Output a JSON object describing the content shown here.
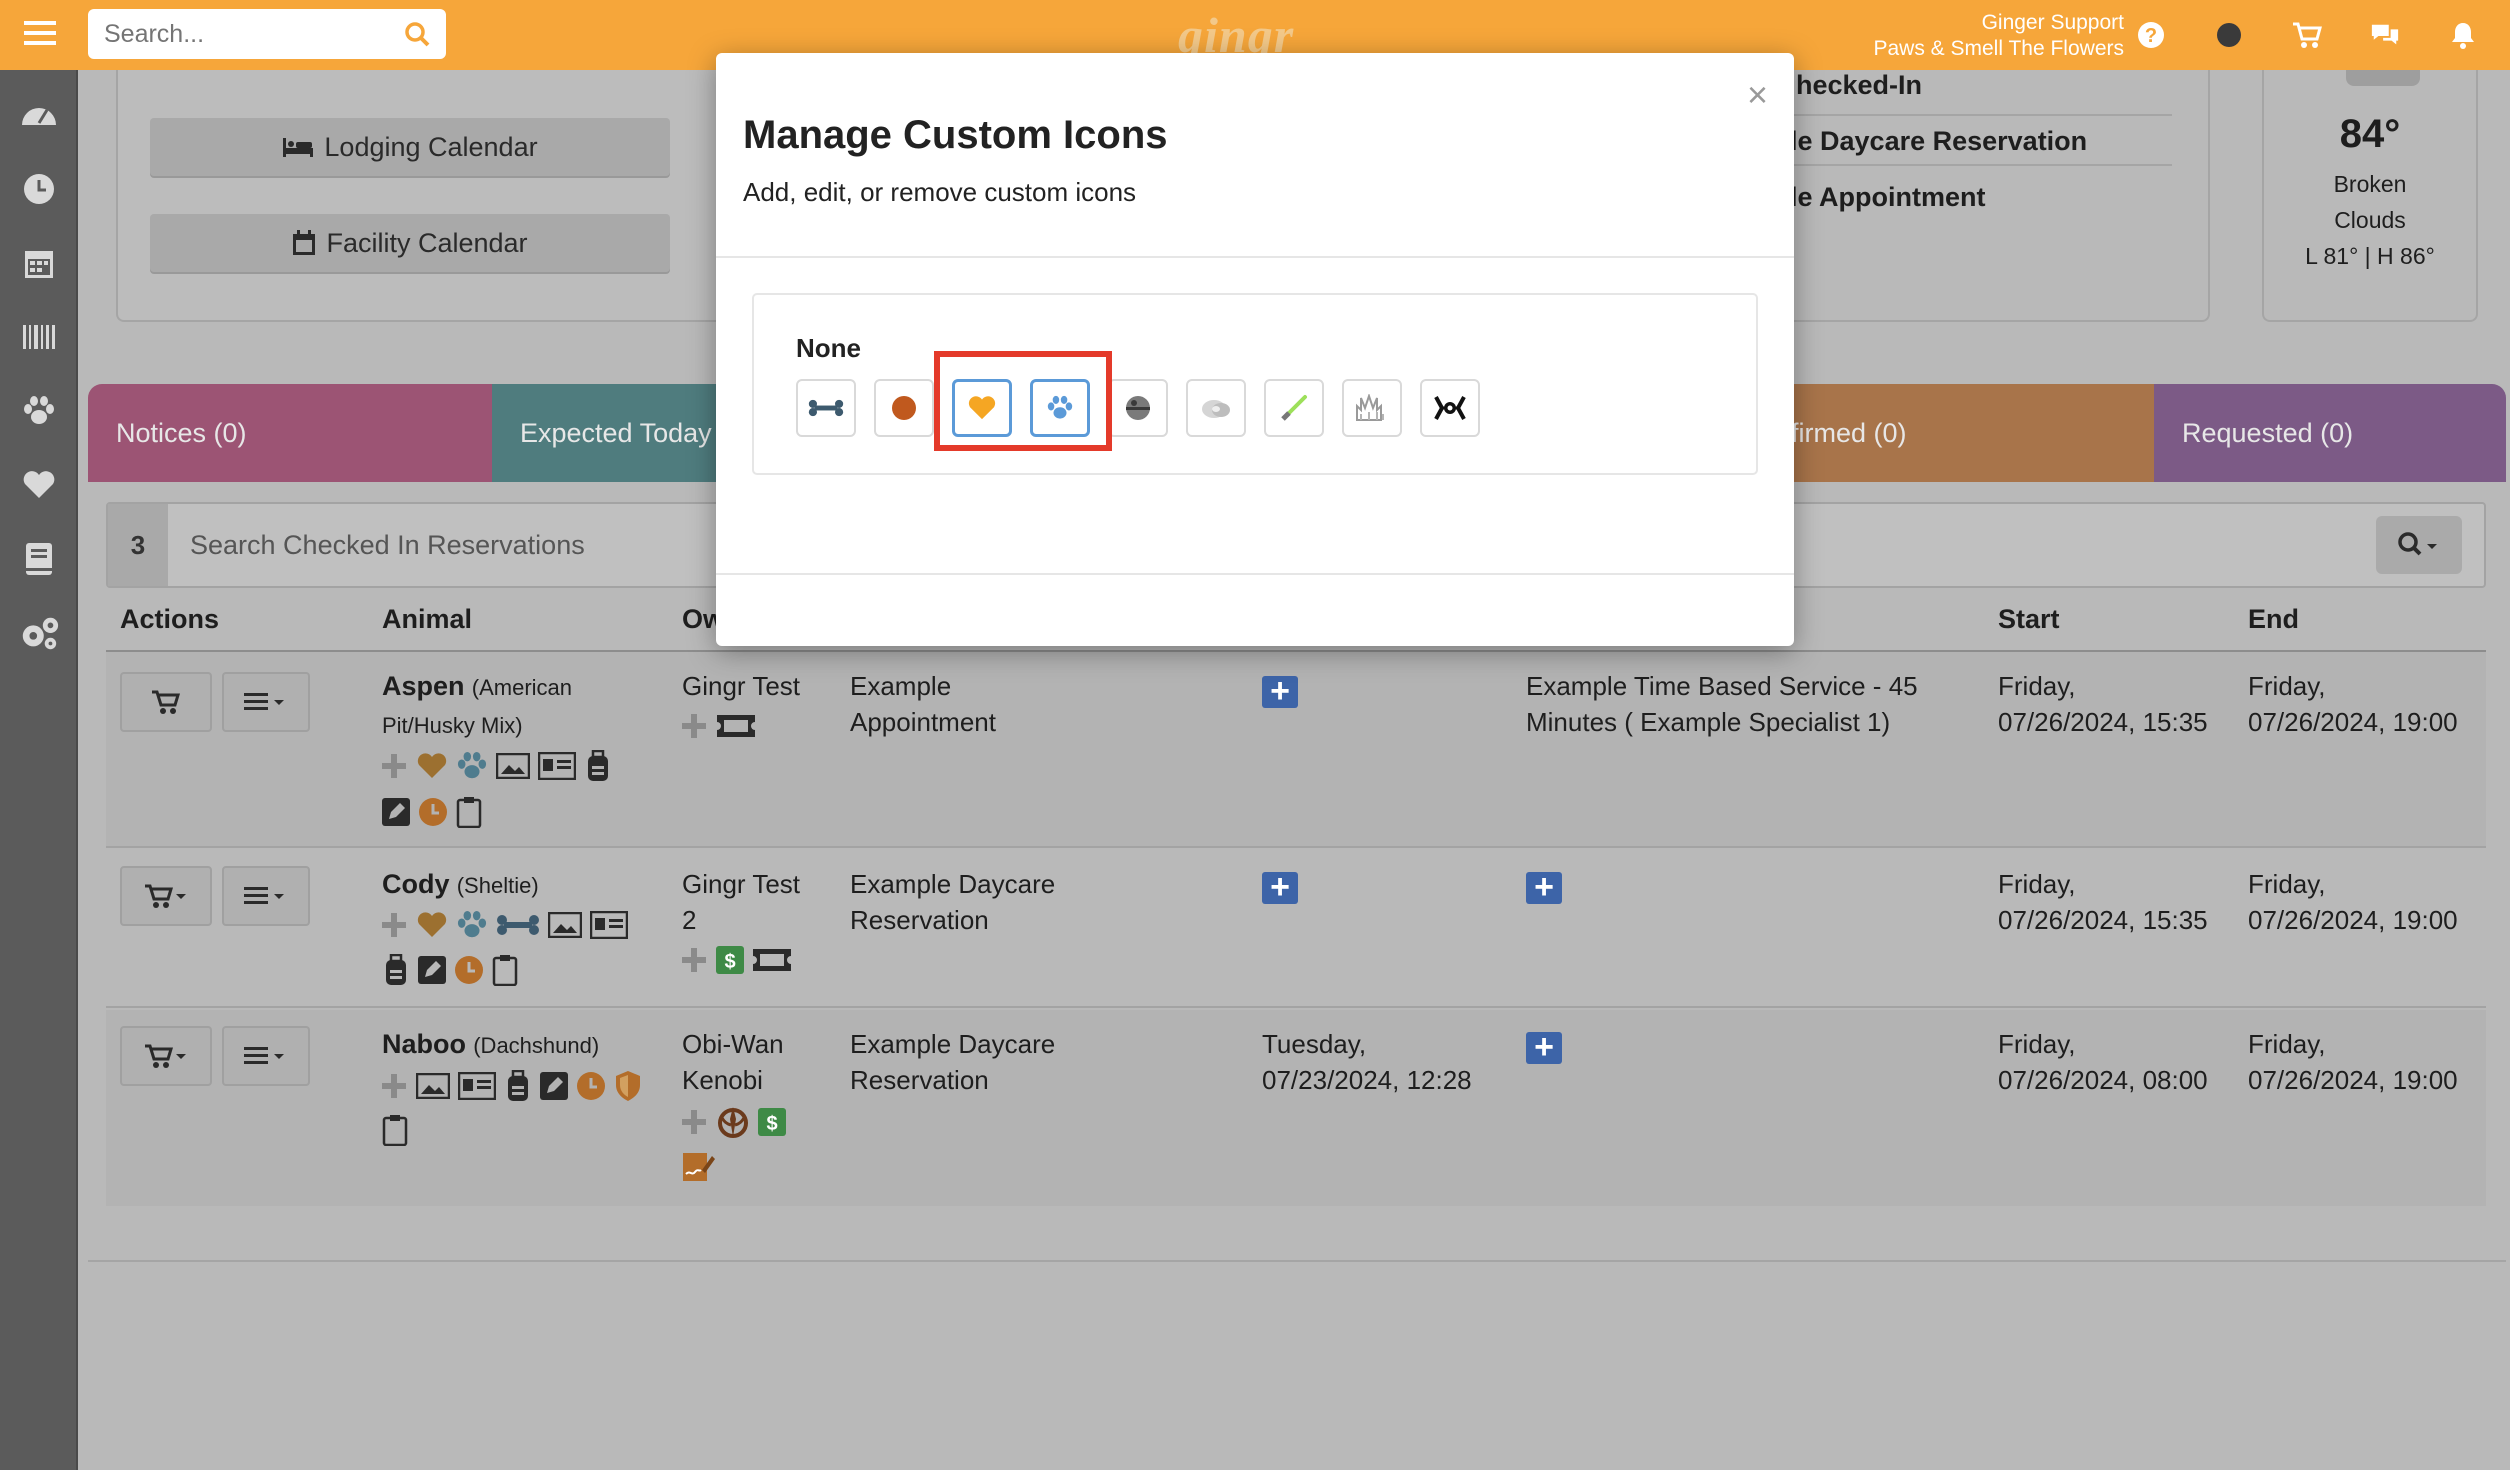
{
  "topbar": {
    "search_placeholder": "Search...",
    "logo": "gingr",
    "user_name": "Ginger Support",
    "location": "Paws & Smell The Flowers"
  },
  "calendar_card": {
    "lodging_label": "Lodging Calendar",
    "facility_label": "Facility Calendar"
  },
  "right_card": {
    "line1": "hecked-In",
    "line2": "le Daycare Reservation",
    "line3": "le Appointment"
  },
  "weather": {
    "temp": "84°",
    "desc1": "Broken",
    "desc2": "Clouds",
    "range": "L 81° | H 86°"
  },
  "tabs": {
    "notices": "Notices (0)",
    "expected": "Expected Today",
    "unconfirmed": "nfirmed (0)",
    "requested": "Requested (0)"
  },
  "reservations_search": {
    "count": "3",
    "placeholder": "Search Checked In Reservations"
  },
  "table": {
    "headers": {
      "actions": "Actions",
      "animal": "Animal",
      "owner": "Ow",
      "start": "Start",
      "end": "End"
    },
    "rows": [
      {
        "animal": "Aspen",
        "breed_a": "(American",
        "breed_b": "Pit/Husky Mix)",
        "owner": "Gingr Test",
        "type_a": "Example",
        "type_b": "Appointment",
        "service_a": "Example Time Based Service - 45",
        "service_b": "Minutes ( Example Specialist 1)",
        "start_a": "Friday,",
        "start_b": "07/26/2024, 15:35",
        "end_a": "Friday,",
        "end_b": "07/26/2024, 19:00"
      },
      {
        "animal": "Cody",
        "breed_a": "(Sheltie)",
        "owner_a": "Gingr Test",
        "owner_b": "2",
        "type_a": "Example Daycare",
        "type_b": "Reservation",
        "start_a": "Friday,",
        "start_b": "07/26/2024, 15:35",
        "end_a": "Friday,",
        "end_b": "07/26/2024, 19:00"
      },
      {
        "animal": "Naboo",
        "breed_a": "(Dachshund)",
        "owner_a": "Obi-Wan",
        "owner_b": "Kenobi",
        "type_a": "Example Daycare",
        "type_b": "Reservation",
        "checkin_a": "Tuesday,",
        "checkin_b": "07/23/2024, 12:28",
        "start_a": "Friday,",
        "start_b": "07/26/2024, 08:00",
        "end_a": "Friday,",
        "end_b": "07/26/2024, 19:00"
      }
    ]
  },
  "modal": {
    "title": "Manage Custom Icons",
    "subtitle": "Add, edit, or remove custom icons",
    "none_label": "None",
    "close": "×",
    "icons": [
      "bone-icon",
      "circle-icon",
      "heart-icon",
      "paw-icon",
      "death-star-icon",
      "cloud-icon",
      "lightsaber-icon",
      "castle-icon",
      "tie-fighter-icon"
    ],
    "selected": [
      "heart-icon",
      "paw-icon"
    ]
  },
  "colors": {
    "topbar": "#f6a63a",
    "sidebar": "#5b5b5b",
    "selected_border": "#5b9ad8",
    "highlight": "#e43a2a",
    "heart": "#f5a623",
    "paw": "#5b9ad8"
  }
}
